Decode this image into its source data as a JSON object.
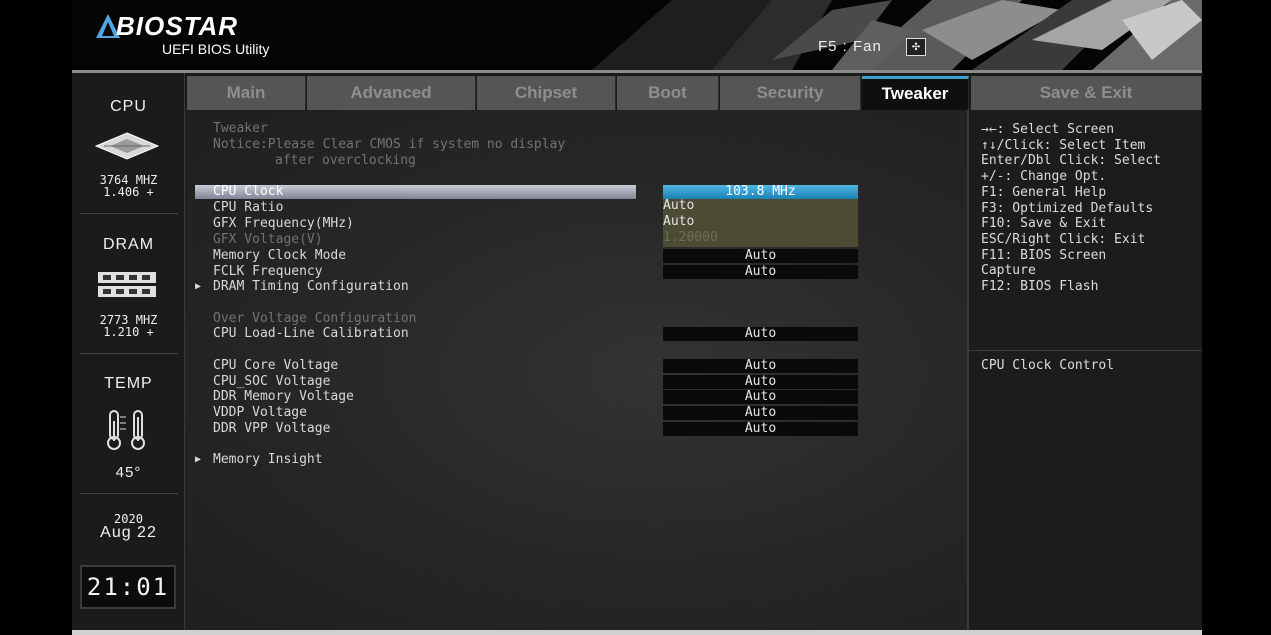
{
  "brand": {
    "name": "BIOSTAR",
    "subtitle": "UEFI BIOS Utility"
  },
  "header": {
    "fan_label": "F5 : Fan",
    "fan_icon": "fan-icon"
  },
  "status": {
    "cpu": {
      "label": "CPU",
      "freq": "3764 MHZ",
      "volt": "1.406 +"
    },
    "dram": {
      "label": "DRAM",
      "freq": "2773 MHZ",
      "volt": "1.210 +"
    },
    "temp": {
      "label": "TEMP",
      "value": "45°"
    },
    "date": {
      "year": "2020",
      "day": "Aug 22"
    },
    "time": "21:01"
  },
  "tabs": [
    "Main",
    "Advanced",
    "Chipset",
    "Boot",
    "Security",
    "Tweaker",
    "Save & Exit"
  ],
  "active_tab": "Tweaker",
  "main": {
    "title": "Tweaker",
    "notice_1": "Notice:Please Clear CMOS if system no display",
    "notice_2": "after overclocking",
    "items": [
      {
        "label": "CPU Clock",
        "value": "103.8 MHz"
      },
      {
        "label": "CPU Ratio",
        "value": "Auto"
      },
      {
        "label": "GFX Frequency(MHz)",
        "value": "Auto"
      },
      {
        "label": "GFX Voltage(V)",
        "value": "1.20000"
      },
      {
        "label": "Memory Clock Mode",
        "value": "Auto"
      },
      {
        "label": "FCLK Frequency",
        "value": "Auto"
      },
      {
        "label": "DRAM Timing Configuration"
      },
      {
        "label": "Over Voltage Configuration"
      },
      {
        "label": "CPU Load-Line Calibration",
        "value": "Auto"
      },
      {
        "label": "CPU Core Voltage",
        "value": "Auto"
      },
      {
        "label": "CPU_SOC Voltage",
        "value": "Auto"
      },
      {
        "label": "DDR Memory Voltage",
        "value": "Auto"
      },
      {
        "label": "VDDP Voltage",
        "value": "Auto"
      },
      {
        "label": "DDR VPP Voltage",
        "value": "Auto"
      },
      {
        "label": "Memory Insight"
      }
    ]
  },
  "help": {
    "keys": [
      "→←: Select Screen",
      "↑↓/Click: Select Item",
      "Enter/Dbl Click: Select",
      "+/-: Change Opt.",
      "F1: General Help",
      "F3: Optimized Defaults",
      "F10: Save & Exit",
      "ESC/Right Click: Exit",
      "F11: BIOS Screen",
      "Capture",
      "F12: BIOS Flash"
    ],
    "description": "CPU Clock Control"
  },
  "colors": {
    "accent": "#3da0cc",
    "selected_value": "#2a9fd6",
    "olive_value": "#4c4b34",
    "tab_inactive": "#555555"
  }
}
